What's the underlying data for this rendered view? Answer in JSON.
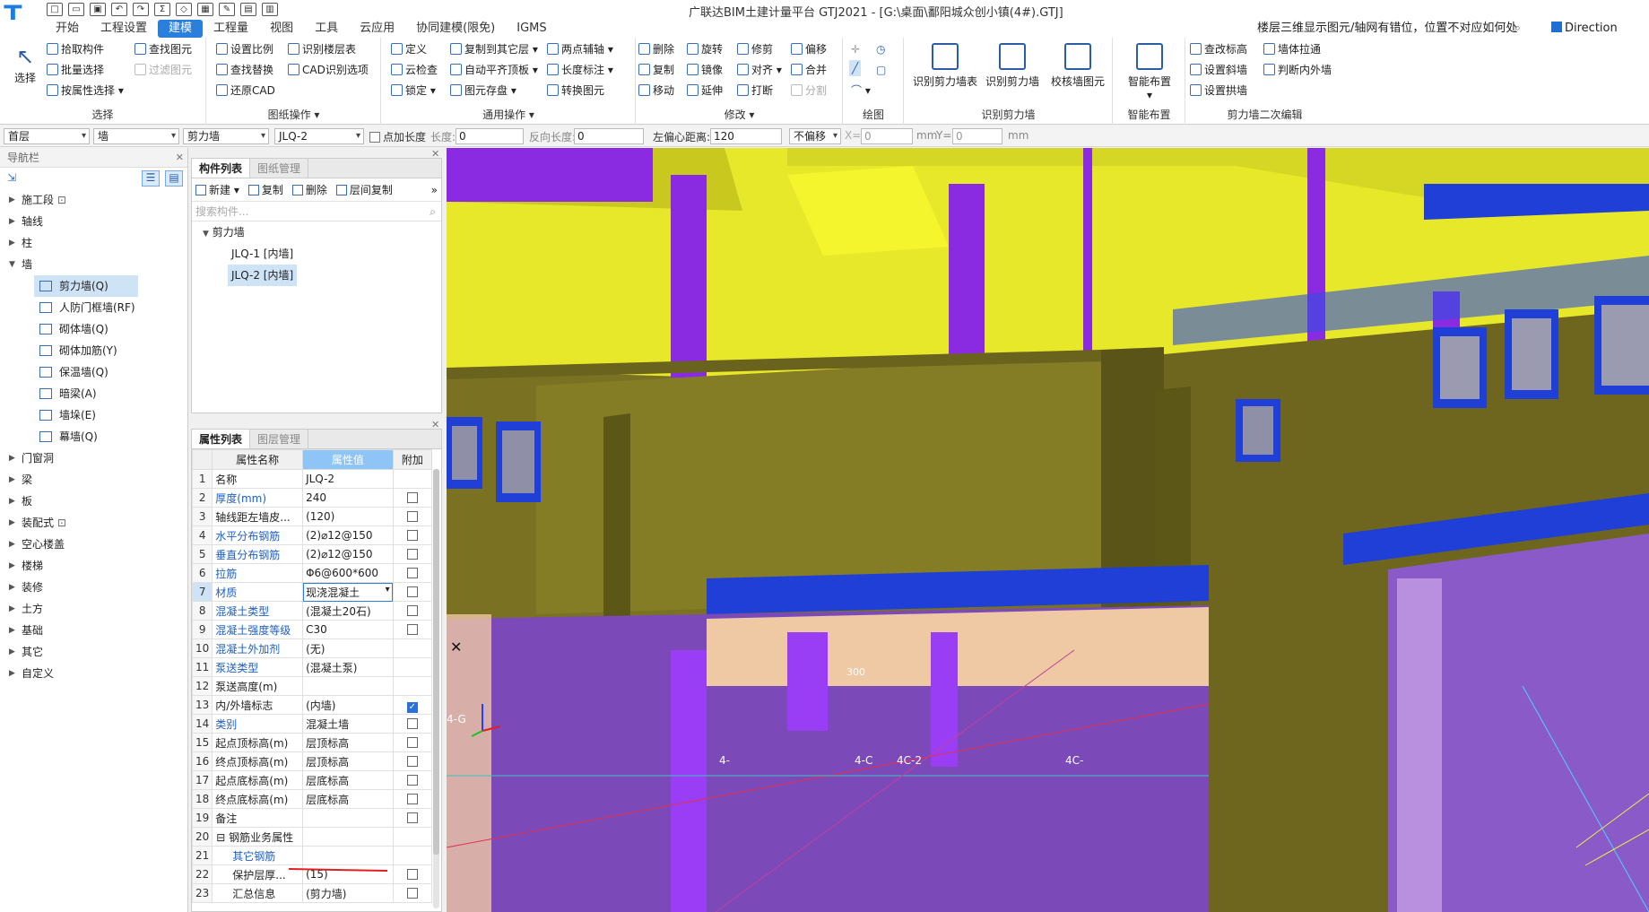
{
  "title": "广联达BIM土建计量平台 GTJ2021 - [G:\\桌面\\鄱阳城众创小镇(4#).GTJ]",
  "logo": "T",
  "menu": [
    "开始",
    "工程设置",
    "建模",
    "工程量",
    "视图",
    "工具",
    "云应用",
    "协同建模(限免)",
    "IGMS"
  ],
  "help_question": "楼层三维显示图元/轴网有错位，位置不对应如何处理?",
  "direction_label": "Direction",
  "ribbon": {
    "select": {
      "big": "选择",
      "items": [
        "拾取构件",
        "批量选择",
        "按属性选择",
        "查找图元",
        "过滤图元"
      ],
      "label": "选择"
    },
    "drawing": {
      "items": [
        "设置比例",
        "识别楼层表",
        "查找替换",
        "CAD识别选项",
        "还原CAD"
      ],
      "label": "图纸操作"
    },
    "common": {
      "items": [
        "定义",
        "复制到其它层",
        "两点辅轴",
        "云检查",
        "自动平齐顶板",
        "长度标注",
        "锁定",
        "图元存盘",
        "转换图元"
      ],
      "label": "通用操作"
    },
    "modify": {
      "items": [
        "删除",
        "旋转",
        "修剪",
        "偏移",
        "复制",
        "镜像",
        "对齐",
        "合并",
        "移动",
        "延伸",
        "打断",
        "分割"
      ],
      "label": "修改"
    },
    "draw": {
      "label": "绘图"
    },
    "recognize": {
      "items": [
        "识别剪力墙表",
        "识别剪力墙",
        "校核墙图元"
      ],
      "label": "识别剪力墙"
    },
    "smart": {
      "items": [
        "智能布置"
      ],
      "label": "智能布置"
    },
    "secondary": {
      "items": [
        "查改标高",
        "墙体拉通",
        "设置斜墙",
        "判断内外墙",
        "设置拱墙"
      ],
      "label": "剪力墙二次编辑"
    }
  },
  "propbar": {
    "floor": "首层",
    "category": "墙",
    "type": "剪力墙",
    "name": "JLQ-2",
    "add_length": "点加长度",
    "length_label": "长度:",
    "length_value": "0",
    "reverse_label": "反向长度:",
    "reverse_value": "0",
    "offset_label": "左偏心距离:",
    "offset_value": "120",
    "nomove": "不偏移",
    "x_label": "X=",
    "x_value": "0",
    "mm1": "mm",
    "y_label": "Y=",
    "y_value": "0",
    "mm2": "mm"
  },
  "nav": {
    "title": "导航栏",
    "items_top": [
      "施工段",
      "轴线",
      "柱",
      "墙"
    ],
    "sub_items": [
      "剪力墙(Q)",
      "人防门框墙(RF)",
      "砌体墙(Q)",
      "砌体加筋(Y)",
      "保温墙(Q)",
      "暗梁(A)",
      "墙垛(E)",
      "幕墙(Q)"
    ],
    "items_bottom": [
      "门窗洞",
      "梁",
      "板",
      "装配式",
      "空心楼盖",
      "楼梯",
      "装修",
      "土方",
      "基础",
      "其它",
      "自定义"
    ]
  },
  "component_list": {
    "tabs": [
      "构件列表",
      "图纸管理"
    ],
    "tools": [
      "新建",
      "复制",
      "删除",
      "层间复制"
    ],
    "search_placeholder": "搜索构件...",
    "tree_root": "剪力墙",
    "tree_items": [
      "JLQ-1 [内墙]",
      "JLQ-2 [内墙]"
    ]
  },
  "property_list": {
    "tabs": [
      "属性列表",
      "图层管理"
    ],
    "headers": [
      "属性名称",
      "属性值",
      "附加"
    ],
    "rows": [
      [
        "1",
        "名称",
        "JLQ-2",
        ""
      ],
      [
        "2",
        "厚度(mm)",
        "240",
        "box"
      ],
      [
        "3",
        "轴线距左墙皮...",
        "(120)",
        "box"
      ],
      [
        "4",
        "水平分布钢筋",
        "(2)⌀12@150",
        "box"
      ],
      [
        "5",
        "垂直分布钢筋",
        "(2)⌀12@150",
        "box"
      ],
      [
        "6",
        "拉筋",
        "Φ6@600*600",
        "box"
      ],
      [
        "7",
        "材质",
        "现浇混凝土",
        "box"
      ],
      [
        "8",
        "混凝土类型",
        "(混凝土20石)",
        "box"
      ],
      [
        "9",
        "混凝土强度等级",
        "C30",
        "box"
      ],
      [
        "10",
        "混凝土外加剂",
        "(无)",
        ""
      ],
      [
        "11",
        "泵送类型",
        "(混凝土泵)",
        ""
      ],
      [
        "12",
        "泵送高度(m)",
        "",
        ""
      ],
      [
        "13",
        "内/外墙标志",
        "(内墙)",
        "on"
      ],
      [
        "14",
        "类别",
        "混凝土墙",
        "box"
      ],
      [
        "15",
        "起点顶标高(m)",
        "层顶标高",
        "box"
      ],
      [
        "16",
        "终点顶标高(m)",
        "层顶标高",
        "box"
      ],
      [
        "17",
        "起点底标高(m)",
        "层底标高",
        "box"
      ],
      [
        "18",
        "终点底标高(m)",
        "层底标高",
        "box"
      ],
      [
        "19",
        "备注",
        "",
        "box"
      ],
      [
        "20",
        "钢筋业务属性",
        "",
        ""
      ],
      [
        "21",
        "其它钢筋",
        "",
        ""
      ],
      [
        "22",
        "保护层厚...",
        "(15)",
        "box"
      ],
      [
        "23",
        "汇总信息",
        "(剪力墙)",
        "box"
      ]
    ],
    "blue_rows": [
      "2",
      "4",
      "5",
      "6",
      "7",
      "8",
      "9",
      "10",
      "11",
      "14",
      "21"
    ]
  },
  "viewport_labels": [
    "4-G",
    "4-C",
    "4C-2",
    "4C-",
    "300",
    "4-"
  ],
  "colors": {
    "accent": "#2a7fdc",
    "wall_olive": "#7a7222",
    "slab_yellow": "#e6e62a",
    "beam_purple": "#8a2be2",
    "beam_blue": "#1f3fd6"
  }
}
